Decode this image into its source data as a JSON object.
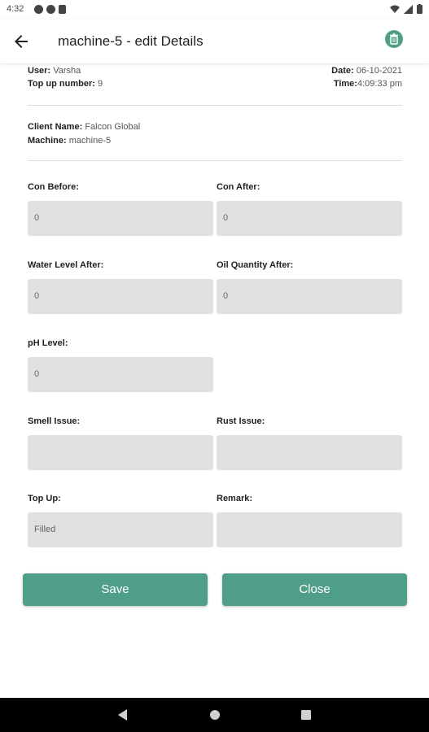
{
  "status_bar": {
    "time": "4:32"
  },
  "app_bar": {
    "title": "machine-5 - edit Details"
  },
  "info": {
    "user_label": "User:",
    "user_value": "Varsha",
    "topup_label": "Top up number:",
    "topup_value": "9",
    "date_label": "Date:",
    "date_value": "06-10-2021",
    "time_label": "Time:",
    "time_value": "4:09:33 pm",
    "client_label": "Client Name:",
    "client_value": "Falcon Global",
    "machine_label": "Machine:",
    "machine_value": "machine-5"
  },
  "fields": {
    "con_before": {
      "label": "Con Before:",
      "value": "0"
    },
    "con_after": {
      "label": "Con After:",
      "value": "0"
    },
    "water_level_after": {
      "label": "Water Level After:",
      "value": "0"
    },
    "oil_quantity_after": {
      "label": "Oil Quantity After:",
      "value": "0"
    },
    "ph_level": {
      "label": "pH Level:",
      "value": "0"
    },
    "smell_issue": {
      "label": "Smell Issue:",
      "value": ""
    },
    "rust_issue": {
      "label": "Rust Issue:",
      "value": ""
    },
    "top_up": {
      "label": "Top Up:",
      "value": "Filled"
    },
    "remark": {
      "label": "Remark:",
      "value": ""
    }
  },
  "buttons": {
    "save": "Save",
    "close": "Close"
  },
  "colors": {
    "accent": "#4f9e87",
    "field_bg": "#e0e0e0",
    "nav_bar": "#000000"
  }
}
